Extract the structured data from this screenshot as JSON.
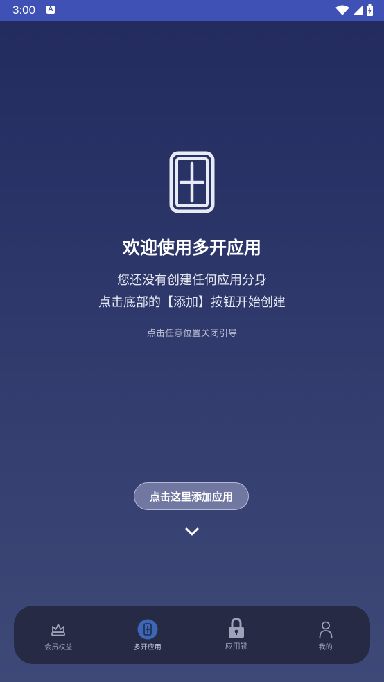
{
  "status_bar": {
    "time": "3:00",
    "notification_icon": "A",
    "icons": [
      "wifi-icon",
      "signal-icon",
      "battery-icon"
    ],
    "color": "#3f51b5"
  },
  "guide": {
    "icon": "split-screen-plus-icon",
    "title": "欢迎使用多开应用",
    "line1": "您还没有创建任何应用分身",
    "line2": "点击底部的【添加】按钮开始创建",
    "dismiss_hint": "点击任意位置关闭引导"
  },
  "add_button": {
    "label": "点击这里添加应用",
    "arrow_icon": "chevron-down-icon"
  },
  "bottom_nav": {
    "items": [
      {
        "label": "会员权益",
        "icon": "crown-icon"
      },
      {
        "label": "多开应用",
        "icon": "multi-app-icon",
        "active": true
      },
      {
        "label": "应用锁",
        "icon": "lock-icon"
      },
      {
        "label": "我的",
        "icon": "person-icon"
      }
    ]
  }
}
